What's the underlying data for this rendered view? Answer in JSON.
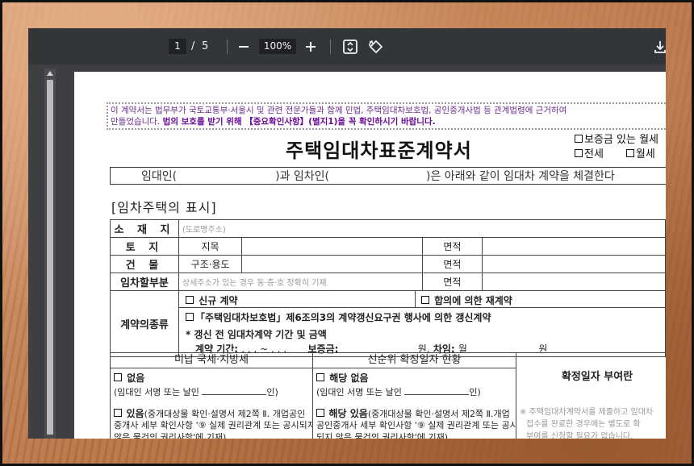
{
  "toolbar": {
    "page_current": "1",
    "page_sep": "/",
    "page_total": "5",
    "zoom_level": "100%"
  },
  "document": {
    "notice_line1": "이 계약서는 법무부가 국토교통부·서울시 및 관련 전문가들과 함께 민법, 주택임대차보호법, 공인중개사법 등 관계법령에 근거하여",
    "notice_line2_prefix": "만들었습니다.",
    "notice_line2_bold": "법의 보호를 받기 위해 【중요확인사항】(별지1)을 꼭 확인하시기 바랍니다.",
    "title": "주택임대차표준계약서",
    "types": [
      "보증금 있는 월세",
      "전세",
      "월세"
    ],
    "intro": {
      "landlord": "임대인(",
      "mid": ")과 임차인(",
      "end": ")은 아래와 같이 임대차 계약을 체결한다"
    },
    "section_title": "[임차주택의 표시]",
    "rows": {
      "location_label": "소 재 지",
      "location_hint": "(도로명주소)",
      "land_label": "토 지",
      "land_sub": "지목",
      "land_area": "면적",
      "building_label": "건 물",
      "building_sub": "구조·용도",
      "building_area": "면적",
      "rent_part_label": "임차할부분",
      "rent_part_hint": "상세주소가 있는 경우 동·층·호 정확히 기재",
      "rent_part_area": "면적",
      "contract_type_label": "계약의종류",
      "contract_new": "신규 계약",
      "contract_renew": "합의에 의한 재계약",
      "contract_right": "「주택임대차보호법」제6조의3의 계약갱신요구권 행사에 의한 갱신계약",
      "prev_contract": "* 갱신 전 임대차계약 기간 및 금액",
      "prev_period": "계약 기간:",
      "prev_dots": ".     .     . ~     .     .     .",
      "prev_deposit": "보증금:",
      "prev_won": "원,",
      "prev_rent": "차임:",
      "prev_month": "월",
      "prev_won2": "원"
    },
    "bottom": {
      "tax_head": "미납 국세·지방세",
      "tax_none": "없음",
      "tax_sign": "(임대인 서명 또는 날인",
      "tax_sign_end": "인)",
      "tax_have": "있음",
      "tax_have_desc1": "(중개대상물 확인·설명서 제2쪽 Ⅱ. 개업공인",
      "tax_have_desc2": "중개사 세부 확인사항 '⑨ 실제 권리관계 또는 공시되지",
      "tax_have_desc3": "않은 물건의 권리사항'에 기재)",
      "prior_head": "선순위 확정일자 현황",
      "prior_none": "해당 없음",
      "prior_sign": "(임대인 서명 또는 날인",
      "prior_sign_end": "인)",
      "prior_have": "해당 있음",
      "prior_have_desc1": "(중개대상물 확인·설명서 제2쪽 Ⅱ.개업",
      "prior_have_desc2": "공인중개사 세부 확인사항 '⑨ 실제 권리관계 또는 공시",
      "prior_have_desc3": "되지 않은 물건의 권리사항'에 기재)",
      "fixed_head": "확정일자 부여란",
      "fixed_note1": "※ 주택임대차계약서를 제출하고 임대차",
      "fixed_note2": "접수를 완료한 경우에는 별도로 확",
      "fixed_note3": "부여를 신청할 필요가 없습니다."
    }
  }
}
